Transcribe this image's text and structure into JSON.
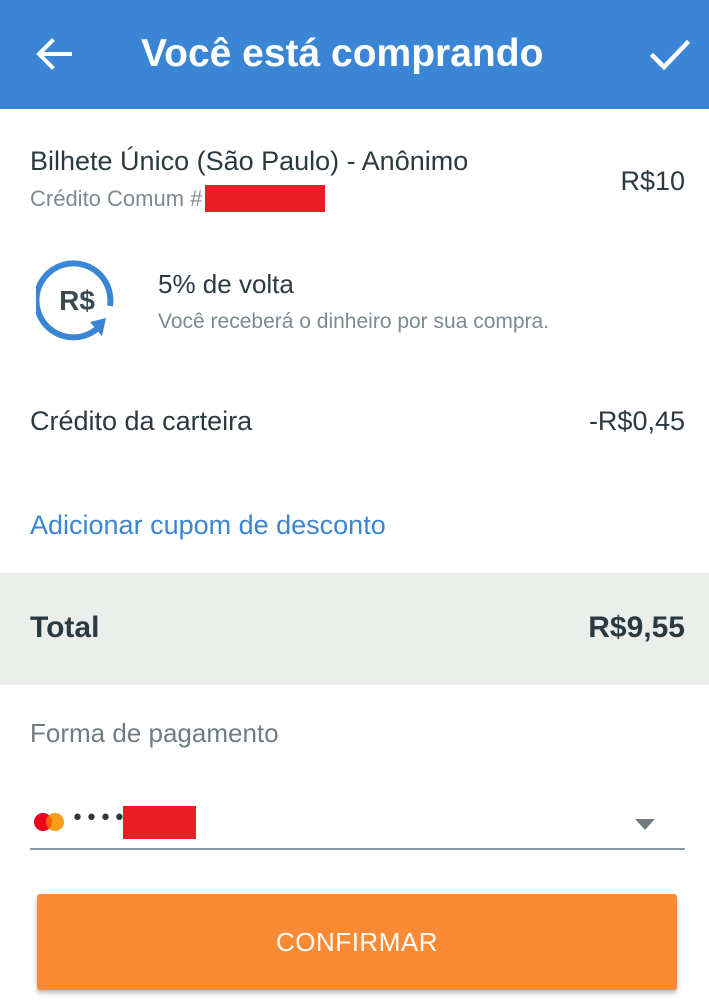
{
  "appbar": {
    "title": "Você está comprando",
    "back_icon": "arrow-left-icon",
    "confirm_icon": "check-icon",
    "color": "#3a86d4"
  },
  "product": {
    "name": "Bilhete Único (São Paulo) - Anônimo",
    "subtitle_prefix": "Crédito Comum #",
    "price": "R$10"
  },
  "cashback": {
    "icon": "refresh-currency-icon",
    "icon_text": "R$",
    "title": "5% de volta",
    "description": "Você receberá o dinheiro por sua compra."
  },
  "wallet": {
    "label": "Crédito da carteira",
    "value": "-R$0,45"
  },
  "coupon": {
    "link_text": "Adicionar cupom de desconto"
  },
  "total": {
    "label": "Total",
    "value": "R$9,55"
  },
  "payment": {
    "label": "Forma de pagamento",
    "card_brand_icon": "mastercard-icon",
    "card_masked": "••••",
    "dropdown_icon": "caret-down-icon"
  },
  "confirm": {
    "label": "CONFIRMAR",
    "color": "#fb8a35"
  }
}
